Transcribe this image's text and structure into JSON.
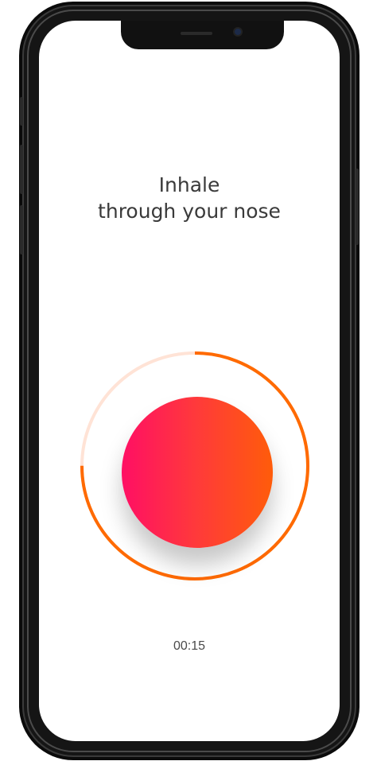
{
  "breathing": {
    "instruction_line1": "Inhale",
    "instruction_line2": "through your nose",
    "timer": "00:15",
    "progress_fraction": 0.75
  },
  "colors": {
    "accent_orange": "#ff6a00",
    "ring_track": "#ffe3d6",
    "gradient_start": "#ff0f64",
    "gradient_end": "#ff5c0a",
    "text": "#3a3a3a"
  },
  "icons": {
    "front_camera": "camera-icon",
    "earpiece": "speaker-icon"
  }
}
